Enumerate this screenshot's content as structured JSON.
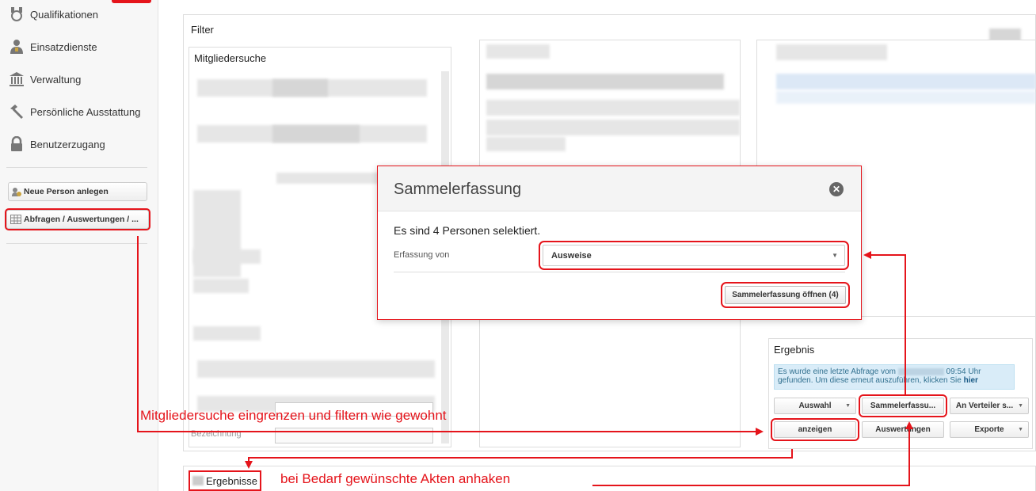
{
  "sidebar": {
    "items": [
      {
        "label": "Qualifikationen",
        "icon": "medal-icon"
      },
      {
        "label": "Einsatzdienste",
        "icon": "person-badge-icon"
      },
      {
        "label": "Verwaltung",
        "icon": "institution-icon"
      },
      {
        "label": "Persönliche Ausstattung",
        "icon": "hammer-icon"
      },
      {
        "label": "Benutzerzugang",
        "icon": "lock-icon"
      }
    ],
    "buttons": {
      "new_person": "Neue Person anlegen",
      "queries": "Abfragen / Auswertungen / ..."
    }
  },
  "filter": {
    "title": "Filter",
    "member_search_title": "Mitgliedersuche",
    "bottom_field_label": "Bezeichnung"
  },
  "modal": {
    "title": "Sammelerfassung",
    "message": "Es sind 4 Personen selektiert.",
    "field_label": "Erfassung von",
    "selected_value": "Ausweise",
    "open_button": "Sammelerfassung öffnen (4)"
  },
  "result": {
    "title": "Ergebnis",
    "info_line1_prefix": "Es wurde eine letzte Abfrage vom",
    "info_time": "09:54 Uhr",
    "info_line2": "gefunden. Um diese erneut auszuführen, klicken Sie",
    "info_link": "hier",
    "buttons": {
      "auswahl": "Auswahl",
      "sammelerfassung": "Sammelerfassu...",
      "verteiler": "An Verteiler s...",
      "anzeigen": "anzeigen",
      "auswertungen": "Auswertungen",
      "exporte": "Exporte"
    }
  },
  "results_bar": {
    "label": "Ergebnisse"
  },
  "annotations": {
    "filter_hint": "Mitgliedersuche eingrenzen und filtern wie gewohnt",
    "check_hint": "bei Bedarf gewünschte Akten anhaken"
  },
  "colors": {
    "annotation_red": "#e5141b",
    "info_blue": "#d9ecf8"
  }
}
